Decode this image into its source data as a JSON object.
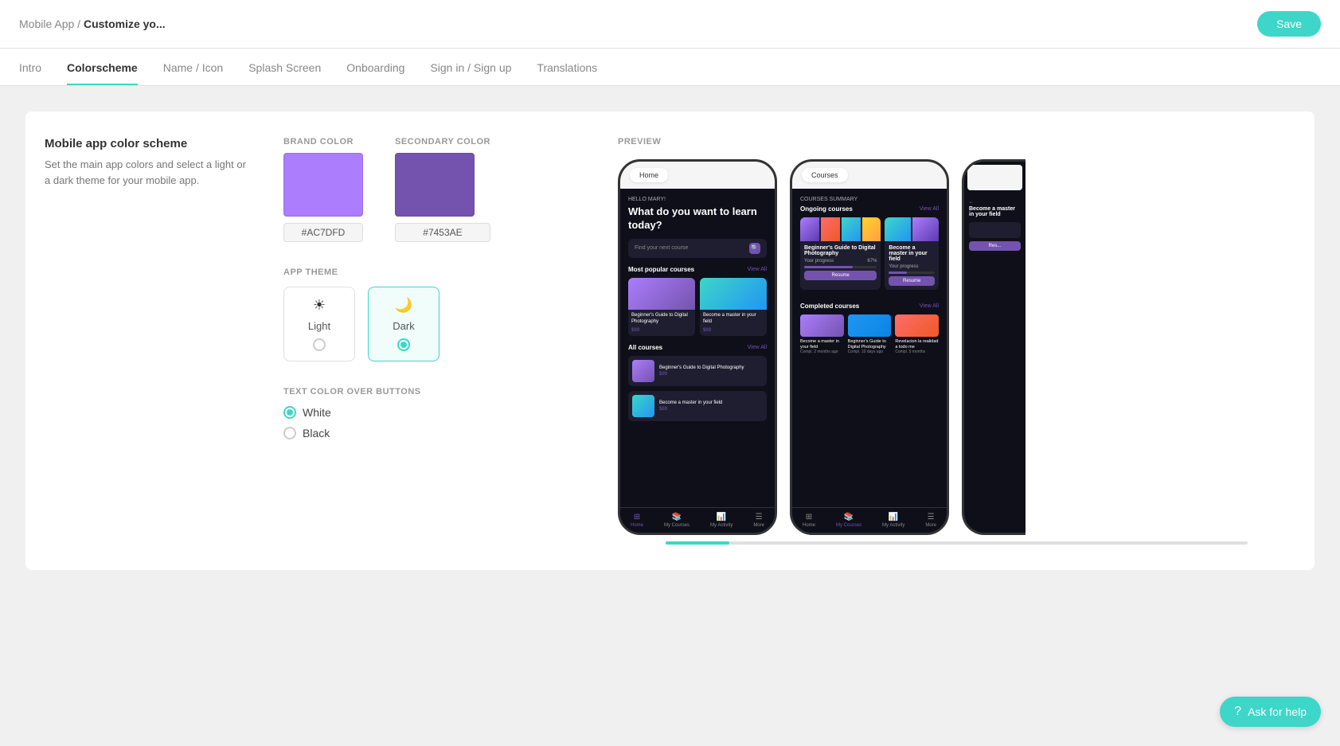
{
  "breadcrumb": {
    "app": "Mobile App",
    "separator": "/",
    "page": "Customize yo..."
  },
  "save_button": "Save",
  "nav": {
    "tabs": [
      {
        "id": "intro",
        "label": "Intro",
        "active": false
      },
      {
        "id": "colorscheme",
        "label": "Colorscheme",
        "active": true
      },
      {
        "id": "name-icon",
        "label": "Name / Icon",
        "active": false
      },
      {
        "id": "splash-screen",
        "label": "Splash Screen",
        "active": false
      },
      {
        "id": "onboarding",
        "label": "Onboarding",
        "active": false
      },
      {
        "id": "sign-in",
        "label": "Sign in / Sign up",
        "active": false
      },
      {
        "id": "translations",
        "label": "Translations",
        "active": false
      }
    ]
  },
  "main": {
    "title": "Mobile app color scheme",
    "description": "Set the main app colors and select a light or a dark theme for your mobile app.",
    "brand_color_label": "BRAND COLOR",
    "brand_color_value": "#AC7DFD",
    "secondary_color_label": "SECONDARY COLOR",
    "secondary_color_value": "#7453AE",
    "app_theme_label": "APP THEME",
    "themes": [
      {
        "id": "light",
        "label": "Light",
        "icon": "☀",
        "selected": false
      },
      {
        "id": "dark",
        "label": "Dark",
        "icon": "🌙",
        "selected": true
      }
    ],
    "text_color_label": "TEXT COLOR OVER BUTTONS",
    "text_colors": [
      {
        "id": "white",
        "label": "White",
        "selected": true
      },
      {
        "id": "black",
        "label": "Black",
        "selected": false
      }
    ]
  },
  "preview": {
    "label": "PREVIEW",
    "phone1": {
      "tab": "Home",
      "greeting": "HELLO MARY!",
      "headline": "What do you want to learn today?",
      "search_placeholder": "Find your next course",
      "section1": "Most popular courses",
      "view_all": "View All",
      "card1_title": "Beginner's Guide to Digital Photography",
      "card1_price": "$99",
      "card2_title": "Become a master in your field",
      "card2_price": "$89",
      "section2": "All courses",
      "list1_title": "Beginner's Guide to Digital Photography",
      "list1_price": "$99",
      "list2_title": "Become a master in your field",
      "list2_price": "$89",
      "nav_items": [
        "Home",
        "My Courses",
        "My Activity",
        "More"
      ]
    },
    "phone2": {
      "tab": "Courses",
      "courses_summary": "COURSES SUMMARY",
      "ongoing_title": "Ongoing courses",
      "view_all": "View All",
      "course1_title": "Beginner's Guide to Digital Photography",
      "progress_label": "Your progress",
      "progress_pct": "67%",
      "resume_btn": "Resume",
      "course2_title": "Become a master in your field",
      "completed_title": "Completed courses",
      "completed1": "Become a master in your field",
      "completed1_date": "Compl. 2 months ago",
      "completed2": "Beginner's Guide to Digital Photography",
      "completed2_date": "Compl. 10 days ago",
      "completed3": "Revelacion la realidad a todo me",
      "completed3_date": "Compl. 5 months",
      "nav_items": [
        "Home",
        "My Courses",
        "My Activity",
        "More"
      ]
    }
  },
  "help_button": "Ask for help"
}
